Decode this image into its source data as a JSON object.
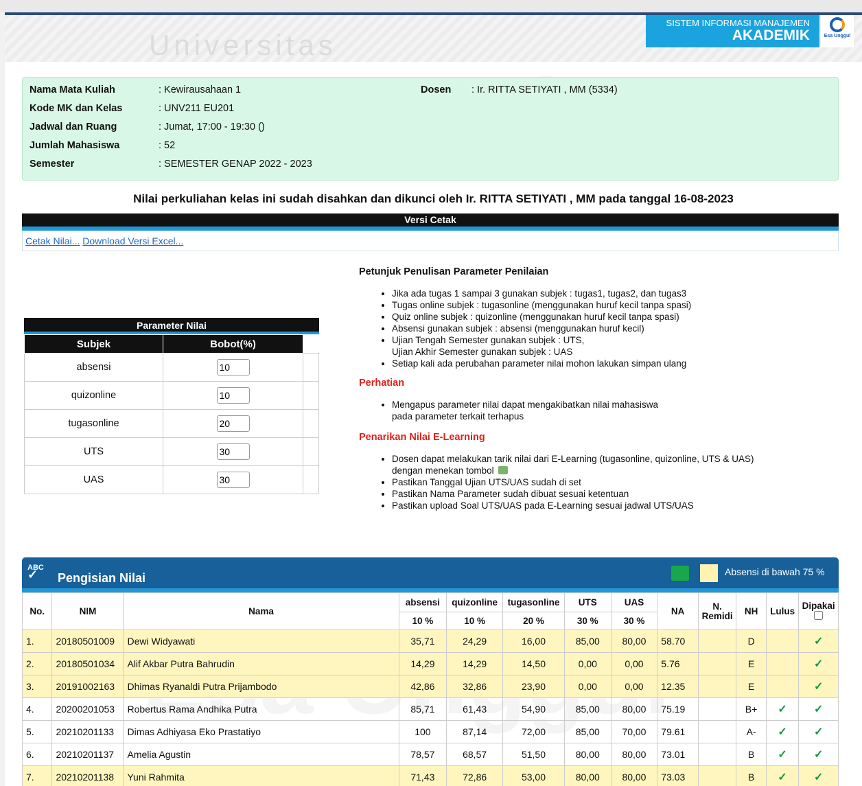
{
  "header": {
    "brand_line1": "SISTEM INFORMASI MANAJEMEN",
    "brand_line2": "AKADEMIK",
    "logo_text": "Esa Unggul",
    "watermark_word1": "Universitas",
    "watermark_word2": "Esa Unggul"
  },
  "info": {
    "course_label": "Nama Mata Kuliah",
    "course_value": ": Kewirausahaan 1",
    "code_label": "Kode MK dan Kelas",
    "code_value": ": UNV211 EU201",
    "schedule_label": "Jadwal dan Ruang",
    "schedule_value": ": Jumat, 17:00 - 19:30 ()",
    "students_label": "Jumlah Mahasiswa",
    "students_value": ": 52",
    "semester_label": "Semester",
    "semester_value": ": SEMESTER GENAP 2022 - 2023",
    "lecturer_label": "Dosen",
    "lecturer_value": ": Ir. RITTA SETIYATI , MM (5334)"
  },
  "lock_message": "Nilai perkuliahan kelas ini sudah disahkan dan dikunci oleh Ir. RITTA SETIYATI , MM pada tanggal 16-08-2023",
  "print_section": {
    "title": "Versi Cetak",
    "link_print": "Cetak Nilai...",
    "link_excel": "Download Versi Excel..."
  },
  "param_table": {
    "title": "Parameter Nilai",
    "col_subject": "Subjek",
    "col_weight": "Bobot(%)",
    "rows": [
      {
        "subject": "absensi",
        "weight": "10"
      },
      {
        "subject": "quizonline",
        "weight": "10"
      },
      {
        "subject": "tugasonline",
        "weight": "20"
      },
      {
        "subject": "UTS",
        "weight": "30"
      },
      {
        "subject": "UAS",
        "weight": "30"
      }
    ]
  },
  "instructions": {
    "title": "Petunjuk Penulisan Parameter Penilaian",
    "items": [
      "Jika ada tugas 1 sampai 3 gunakan subjek : tugas1, tugas2, dan tugas3",
      "Tugas online subjek : tugasonline (menggunakan huruf kecil tanpa spasi)",
      "Quiz online subjek : quizonline (menggunakan huruf kecil tanpa spasi)",
      "Absensi gunakan subjek : absensi (menggunakan huruf kecil)",
      "Ujian Tengah Semester gunakan subjek : UTS,",
      "Ujian Akhir Semester gunakan subjek : UAS",
      "Setiap kali ada perubahan parameter nilai mohon lakukan simpan ulang"
    ],
    "warning_title": "Perhatian",
    "warning_line1": "Mengapus parameter nilai dapat mengakibatkan nilai mahasiswa",
    "warning_line2": "pada parameter terkait terhapus",
    "elearning_title": "Penarikan Nilai E-Learning",
    "elearning_line1": "Dosen dapat melakukan tarik nilai dari E-Learning (tugasonline, quizonline, UTS & UAS)",
    "elearning_line2": "dengan menekan tombol",
    "elearning_items": [
      "Pastikan Tanggal Ujian UTS/UAS sudah di set",
      "Pastikan Nama Parameter sudah dibuat sesuai ketentuan",
      "Pastikan upload Soal UTS/UAS pada E-Learning sesuai jadwal UTS/UAS"
    ]
  },
  "grades": {
    "title": "Pengisian Nilai",
    "abc_icon_text": "ABC",
    "legend": "Absensi di bawah 75 %",
    "columns": {
      "no": "No.",
      "nim": "NIM",
      "nama": "Nama",
      "absensi": "absensi",
      "quizonline": "quizonline",
      "tugasonline": "tugasonline",
      "uts": "UTS",
      "uas": "UAS",
      "na": "NA",
      "remidi": "N. Remidi",
      "nh": "NH",
      "lulus": "Lulus",
      "dipakai": "Dipakai"
    },
    "weights": {
      "absensi": "10 %",
      "quizonline": "10 %",
      "tugasonline": "20 %",
      "uts": "30 %",
      "uas": "30 %"
    },
    "rows": [
      {
        "no": "1.",
        "nim": "20180501009",
        "nama": "Dewi Widyawati",
        "absensi": "35,71",
        "quizonline": "24,29",
        "tugasonline": "16,00",
        "uts": "85,00",
        "uas": "80,00",
        "na": "58.70",
        "remidi": "",
        "nh": "D",
        "lulus": false,
        "dipakai": true,
        "low_attendance": true
      },
      {
        "no": "2.",
        "nim": "20180501034",
        "nama": "Alif Akbar Putra Bahrudin",
        "absensi": "14,29",
        "quizonline": "14,29",
        "tugasonline": "14,50",
        "uts": "0,00",
        "uas": "0,00",
        "na": "5.76",
        "remidi": "",
        "nh": "E",
        "lulus": false,
        "dipakai": true,
        "low_attendance": true
      },
      {
        "no": "3.",
        "nim": "20191002163",
        "nama": "Dhimas Ryanaldi Putra Prijambodo",
        "absensi": "42,86",
        "quizonline": "32,86",
        "tugasonline": "23,90",
        "uts": "0,00",
        "uas": "0,00",
        "na": "12.35",
        "remidi": "",
        "nh": "E",
        "lulus": false,
        "dipakai": true,
        "low_attendance": true
      },
      {
        "no": "4.",
        "nim": "20200201053",
        "nama": "Robertus Rama Andhika Putra",
        "absensi": "85,71",
        "quizonline": "61,43",
        "tugasonline": "54,90",
        "uts": "85,00",
        "uas": "80,00",
        "na": "75.19",
        "remidi": "",
        "nh": "B+",
        "lulus": true,
        "dipakai": true,
        "low_attendance": false
      },
      {
        "no": "5.",
        "nim": "20210201133",
        "nama": "Dimas Adhiyasa Eko Prastatiyo",
        "absensi": "100",
        "quizonline": "87,14",
        "tugasonline": "72,00",
        "uts": "85,00",
        "uas": "70,00",
        "na": "79.61",
        "remidi": "",
        "nh": "A-",
        "lulus": true,
        "dipakai": true,
        "low_attendance": false
      },
      {
        "no": "6.",
        "nim": "20210201137",
        "nama": "Amelia Agustin",
        "absensi": "78,57",
        "quizonline": "68,57",
        "tugasonline": "51,50",
        "uts": "80,00",
        "uas": "80,00",
        "na": "73.01",
        "remidi": "",
        "nh": "B",
        "lulus": true,
        "dipakai": true,
        "low_attendance": false
      },
      {
        "no": "7.",
        "nim": "20210201138",
        "nama": "Yuni Rahmita",
        "absensi": "71,43",
        "quizonline": "72,86",
        "tugasonline": "53,00",
        "uts": "80,00",
        "uas": "80,00",
        "na": "73.03",
        "remidi": "",
        "nh": "B",
        "lulus": true,
        "dipakai": true,
        "low_attendance": true
      }
    ]
  },
  "colors": {
    "brand_blue": "#1ba3dd",
    "header_navy": "#17609a",
    "accent_bar": "#1f97d8",
    "low_attendance_yellow": "#fff6bf",
    "check_green": "#149747",
    "warning_red": "#e0221b"
  }
}
